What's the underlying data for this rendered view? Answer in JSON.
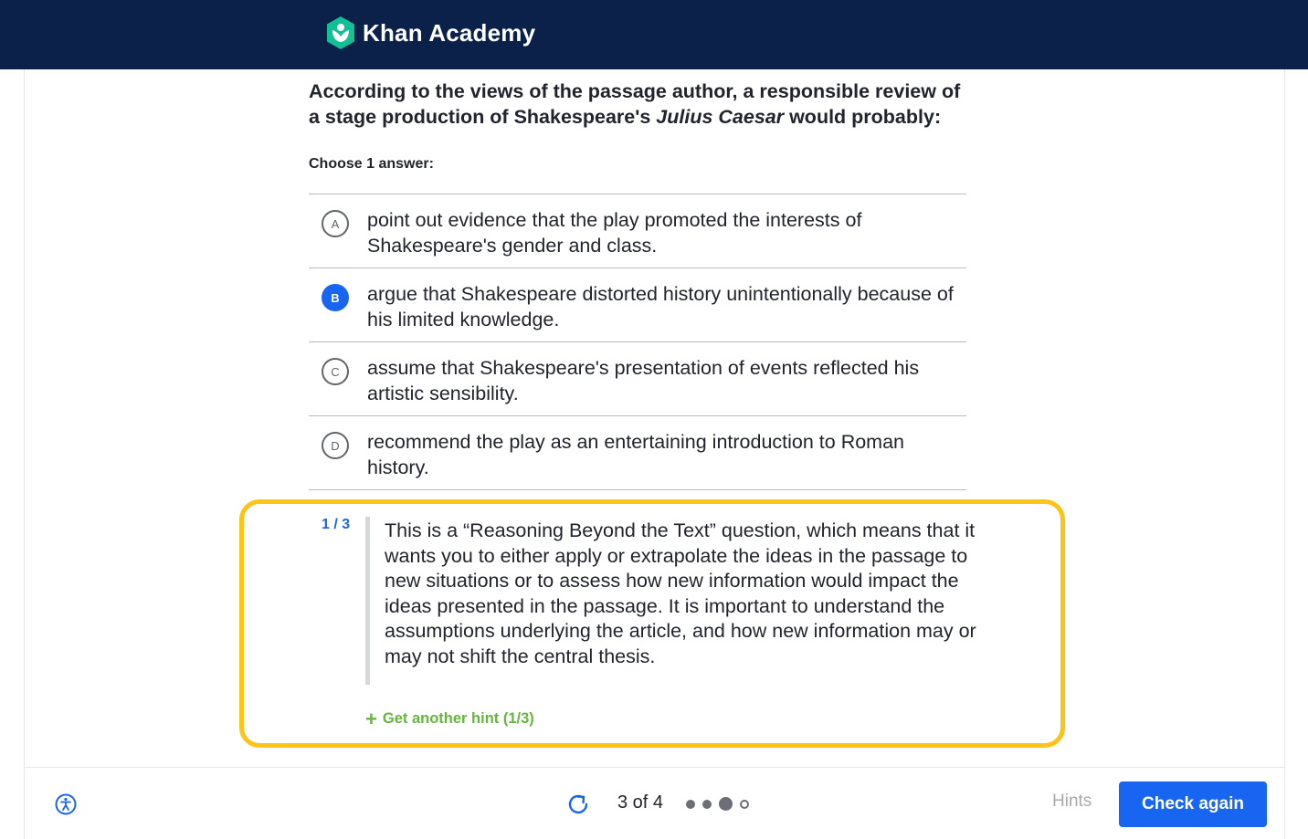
{
  "header": {
    "brand_name": "Khan Academy",
    "logo_icon": "khan-academy-hexagon-logo",
    "background_color": "#0b2149",
    "logo_color": "#14bf96"
  },
  "question": {
    "prompt_before": "According to the views of the passage author, a responsible review of a stage production of Shakespeare's ",
    "prompt_title": "Julius Caesar",
    "prompt_after": " would probably:",
    "instruction": "Choose 1 answer:"
  },
  "choices": [
    {
      "letter": "A",
      "text": "point out evidence that the play promoted the interests of Shakespeare's gender and class.",
      "selected": false
    },
    {
      "letter": "B",
      "text": "argue that Shakespeare distorted history unintentionally because of his limited knowledge.",
      "selected": true
    },
    {
      "letter": "C",
      "text": "assume that Shakespeare's presentation of events reflected his artistic sensibility.",
      "selected": false
    },
    {
      "letter": "D",
      "text": "recommend the play as an entertaining introduction to Roman history.",
      "selected": false
    }
  ],
  "hint": {
    "counter": "1 / 3",
    "text": "This is a “Reasoning Beyond the Text” question, which means that it wants you to either apply or extrapolate the ideas in the passage to new situations or to assess how new information would impact the ideas presented in the passage. It is important to understand the assumptions underlying the article, and how new information may or may not shift the central thesis.",
    "get_another_label": "Get another hint (1/3)",
    "highlight_color": "#fcc419"
  },
  "footer": {
    "accessibility_icon": "accessibility-icon",
    "restart_icon": "restart-icon",
    "progress_text": "3 of 4",
    "progress_dots": [
      "done",
      "done",
      "current",
      "todo"
    ],
    "hints_label": "Hints",
    "check_label": "Check again",
    "accent_color": "#1865f2"
  }
}
